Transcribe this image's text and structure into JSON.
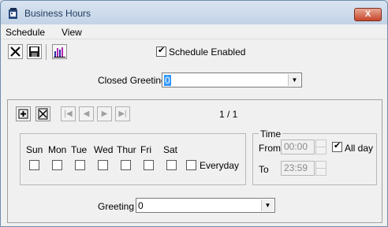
{
  "window": {
    "title": "Business Hours",
    "close_label": "X"
  },
  "menu": {
    "items": [
      "Schedule",
      "View"
    ]
  },
  "toolbar": {
    "schedule_enabled_label": "Schedule Enabled",
    "schedule_enabled": true
  },
  "closed_greeting": {
    "label": "Closed Greeting",
    "value": "0"
  },
  "schedule": {
    "pager": "1 / 1",
    "days": [
      "Sun",
      "Mon",
      "Tue",
      "Wed",
      "Thur",
      "Fri",
      "Sat"
    ],
    "everyday_label": "Everyday"
  },
  "time": {
    "group_label": "Time",
    "from_label": "From",
    "from_value": "00:00",
    "to_label": "To",
    "to_value": "23:59",
    "all_day_label": "All day",
    "all_day": true
  },
  "greeting": {
    "label": "Greeting",
    "value": "0"
  }
}
